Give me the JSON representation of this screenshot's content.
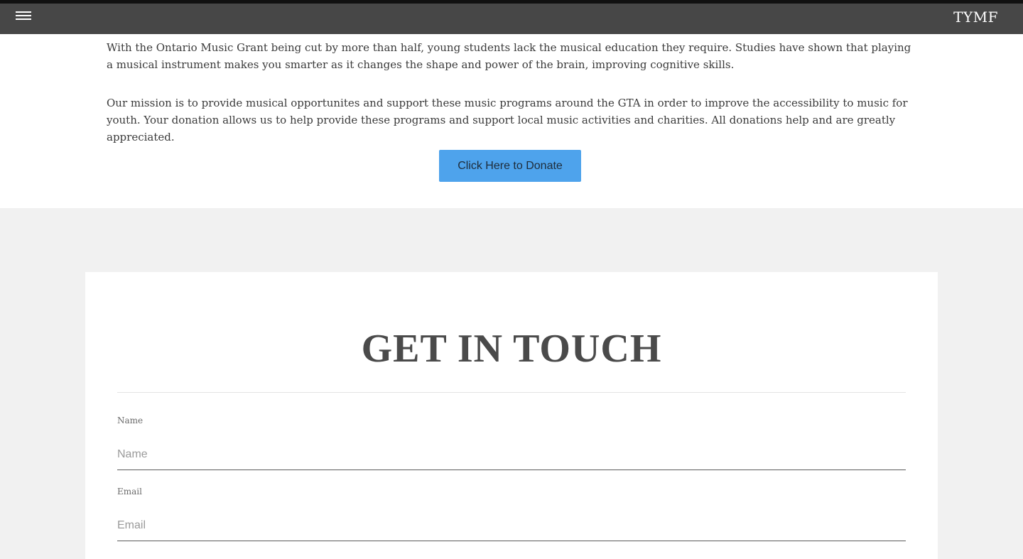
{
  "header": {
    "brand": "TYMF",
    "menu_icon": "hamburger-menu-icon"
  },
  "about": {
    "paragraph_1": "With the Ontario Music Grant being cut by more than half, young students lack the musical education they require. Studies have shown that playing a musical instrument makes you smarter as it changes the shape and power of the brain, improving cognitive skills.",
    "paragraph_2": "Our mission is to provide musical opportunites and support these music programs around the GTA in order to improve the accessibility to music for youth. Your donation allows us to help provide these programs and support local music activities and charities. All donations help and are greatly appreciated.",
    "donate_label": "Click Here to Donate"
  },
  "contact": {
    "title": "GET IN TOUCH",
    "name": {
      "label": "Name",
      "placeholder": "Name",
      "value": ""
    },
    "email": {
      "label": "Email",
      "placeholder": "Email",
      "value": ""
    }
  },
  "colors": {
    "header_bg": "#474747",
    "accent": "#4ea3ec",
    "section_bg": "#f1f1f1",
    "card_bg": "#ffffff"
  }
}
